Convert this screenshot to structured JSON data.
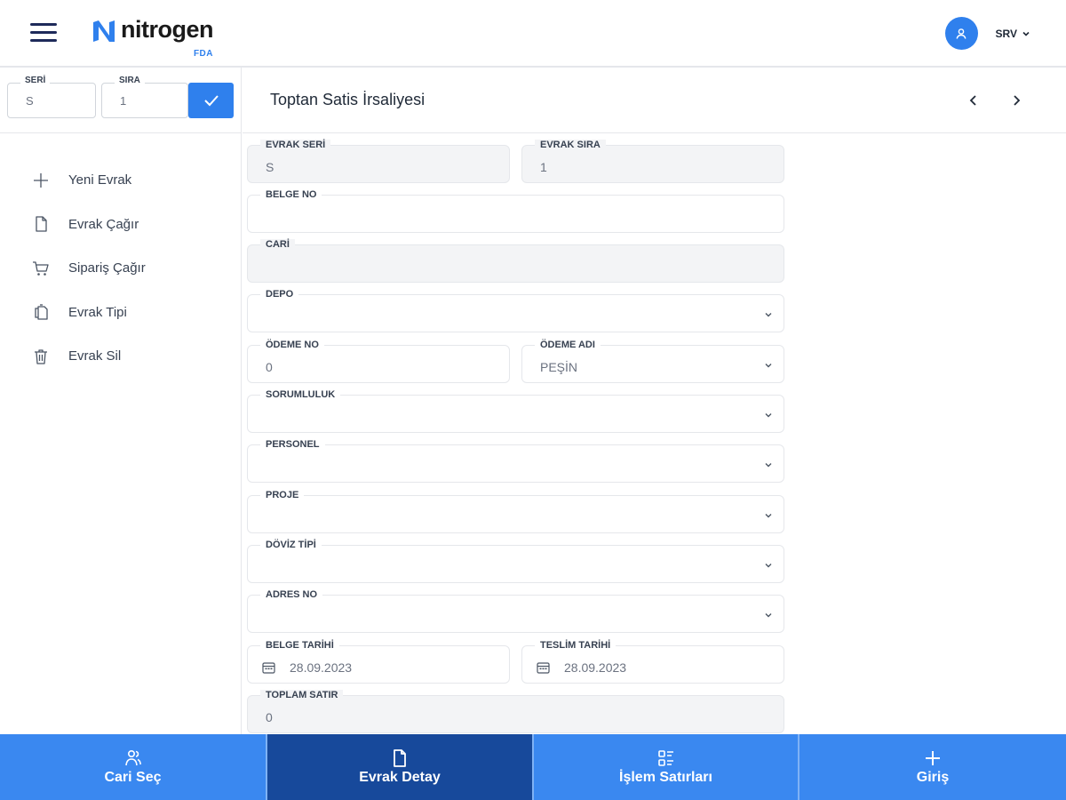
{
  "header": {
    "logo_text": "nitrogen",
    "logo_sub": "FDA",
    "user_name": "SRV"
  },
  "sidebar": {
    "seri": {
      "label": "SERİ",
      "value": "S"
    },
    "sira": {
      "label": "SIRA",
      "value": "1"
    },
    "menu": [
      {
        "label": "Yeni Evrak",
        "icon": "plus-icon"
      },
      {
        "label": "Evrak Çağır",
        "icon": "document-icon"
      },
      {
        "label": "Sipariş Çağır",
        "icon": "cart-icon"
      },
      {
        "label": "Evrak Tipi",
        "icon": "copy-icon"
      },
      {
        "label": "Evrak Sil",
        "icon": "trash-icon"
      }
    ]
  },
  "main": {
    "title": "Toptan Satis İrsaliyesi",
    "fields": {
      "evrak_seri": {
        "label": "EVRAK SERİ",
        "value": "S"
      },
      "evrak_sira": {
        "label": "EVRAK SIRA",
        "value": "1"
      },
      "belge_no": {
        "label": "BELGE NO",
        "value": ""
      },
      "cari": {
        "label": "CARİ",
        "value": ""
      },
      "depo": {
        "label": "DEPO",
        "value": ""
      },
      "odeme_no": {
        "label": "ÖDEME NO",
        "value": "0"
      },
      "odeme_adi": {
        "label": "ÖDEME ADI",
        "value": "PEŞİN"
      },
      "sorumluluk": {
        "label": "SORUMLULUK",
        "value": ""
      },
      "personel": {
        "label": "PERSONEL",
        "value": ""
      },
      "proje": {
        "label": "PROJE",
        "value": ""
      },
      "doviz_tipi": {
        "label": "DÖVİZ TİPİ",
        "value": ""
      },
      "adres_no": {
        "label": "ADRES NO",
        "value": ""
      },
      "belge_tarihi": {
        "label": "BELGE TARİHİ",
        "value": "28.09.2023"
      },
      "teslim_tarihi": {
        "label": "TESLİM TARİHİ",
        "value": "28.09.2023"
      },
      "toplam_satir": {
        "label": "TOPLAM SATIR",
        "value": "0"
      }
    }
  },
  "bottom_tabs": [
    {
      "label": "Cari Seç",
      "icon": "users-icon"
    },
    {
      "label": "Evrak Detay",
      "icon": "document-icon",
      "active": true
    },
    {
      "label": "İşlem Satırları",
      "icon": "list-icon"
    },
    {
      "label": "Giriş",
      "icon": "plus-icon"
    }
  ],
  "colors": {
    "accent": "#2f80ed",
    "active_tab": "#17499b",
    "tab_bg": "#3a88f0"
  }
}
